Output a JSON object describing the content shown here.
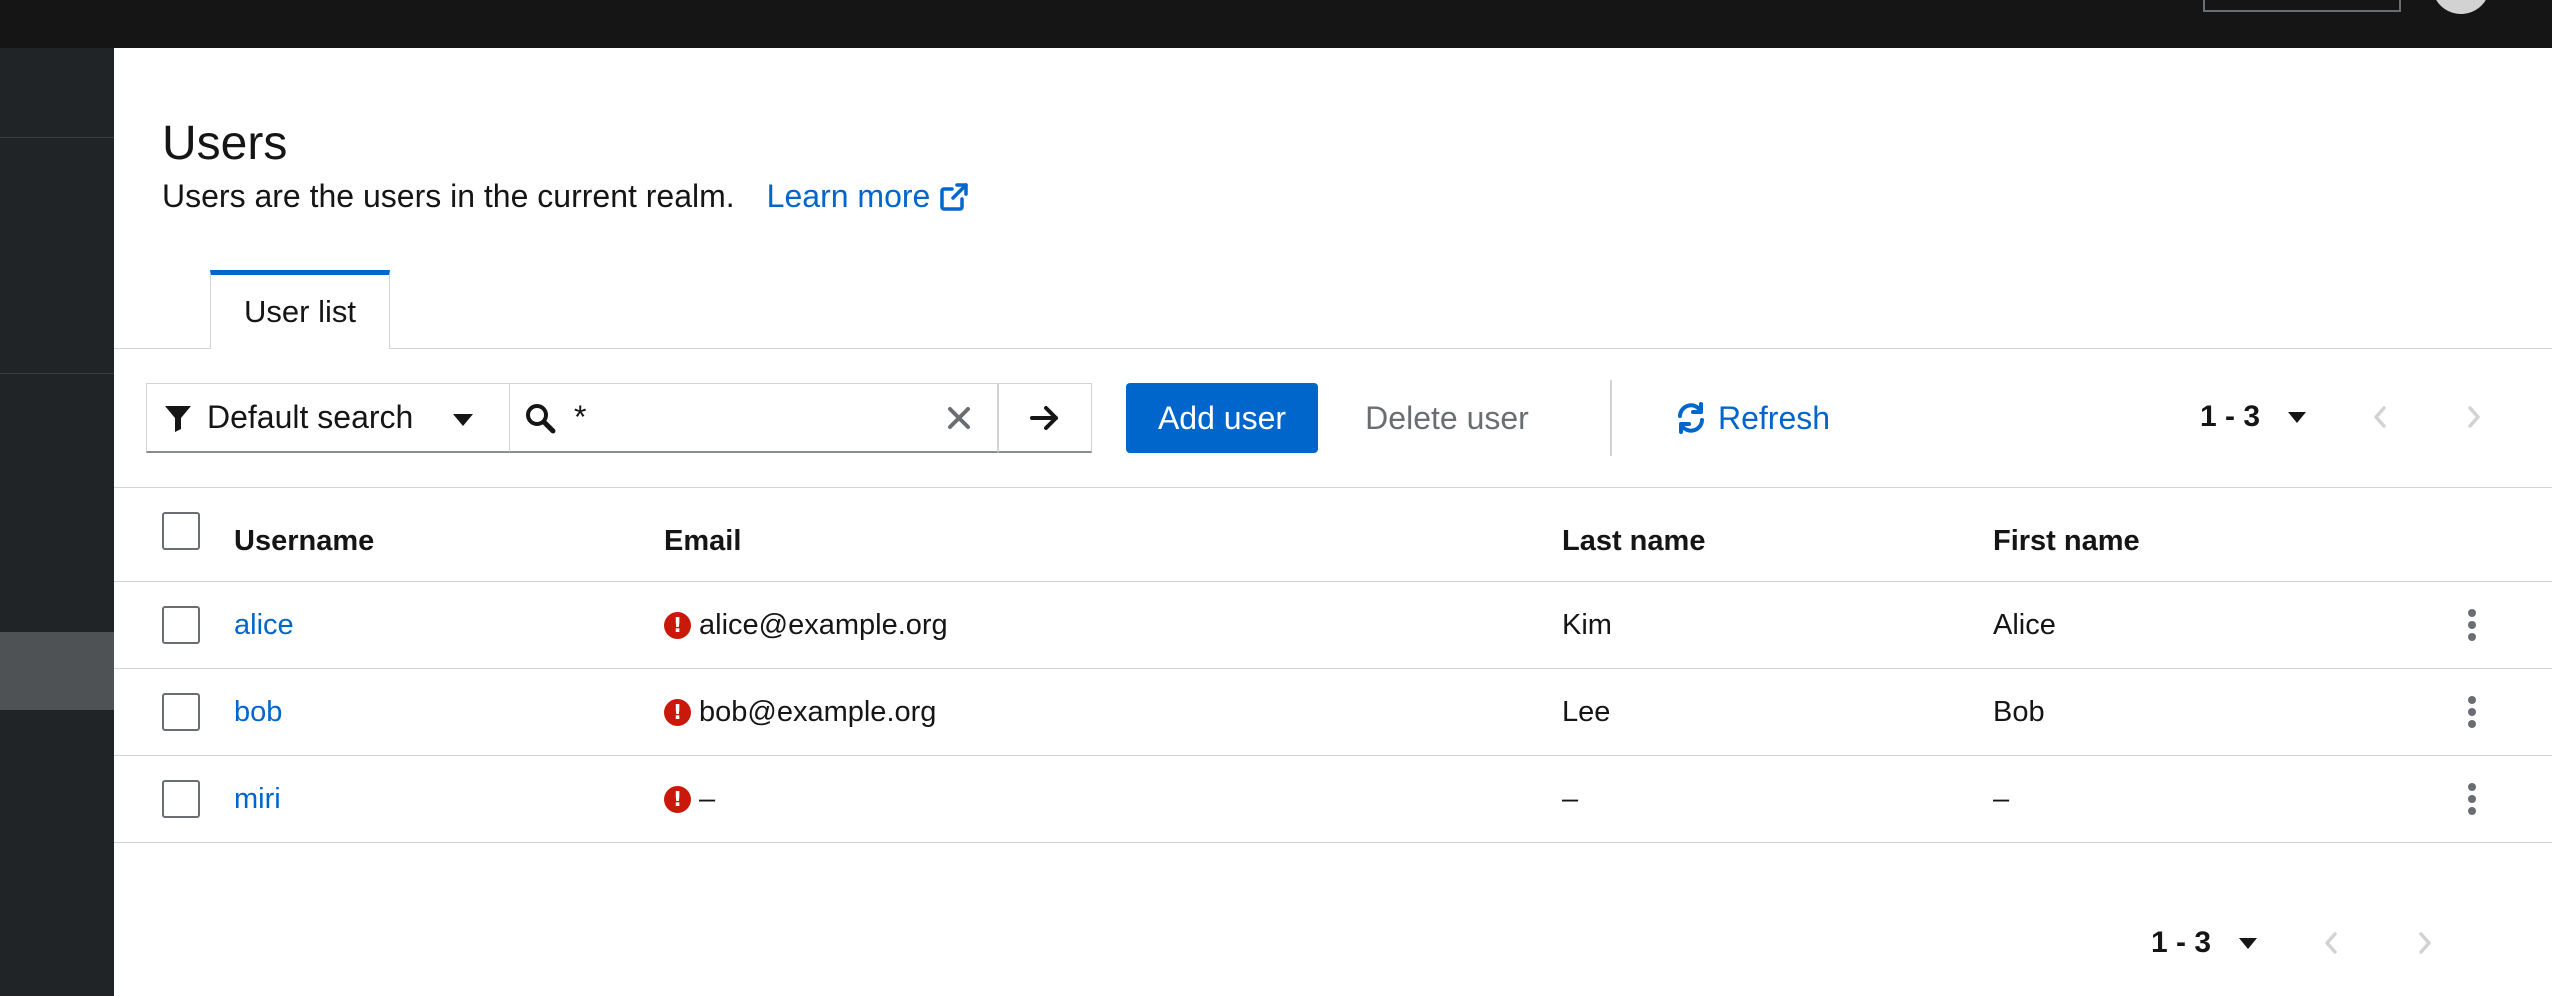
{
  "page": {
    "title": "Users",
    "description": "Users are the users in the current realm.",
    "learn_more": "Learn more"
  },
  "tabs": [
    {
      "label": "User list",
      "active": true
    }
  ],
  "toolbar": {
    "filter_label": "Default search",
    "search_value": "*",
    "add_user": "Add user",
    "delete_user": "Delete user",
    "refresh": "Refresh",
    "pagination_range": "1 - 3"
  },
  "table": {
    "columns": [
      "Username",
      "Email",
      "Last name",
      "First name"
    ],
    "rows": [
      {
        "username": "alice",
        "email": "alice@example.org",
        "last_name": "Kim",
        "first_name": "Alice"
      },
      {
        "username": "bob",
        "email": "bob@example.org",
        "last_name": "Lee",
        "first_name": "Bob"
      },
      {
        "username": "miri",
        "email": "–",
        "last_name": "–",
        "first_name": "–"
      }
    ]
  },
  "footer": {
    "pagination_range": "1 - 3"
  },
  "colors": {
    "accent": "#0066cc",
    "error": "#c9190b",
    "topbar": "#151515",
    "sidebar": "#212427"
  },
  "icons": {
    "filter": "filter-icon",
    "caret": "caret-down-icon",
    "search": "search-icon",
    "clear": "close-icon",
    "go": "arrow-right-icon",
    "refresh": "sync-icon",
    "external": "external-link-icon",
    "error": "exclamation-circle-icon",
    "kebab": "kebab-icon"
  }
}
